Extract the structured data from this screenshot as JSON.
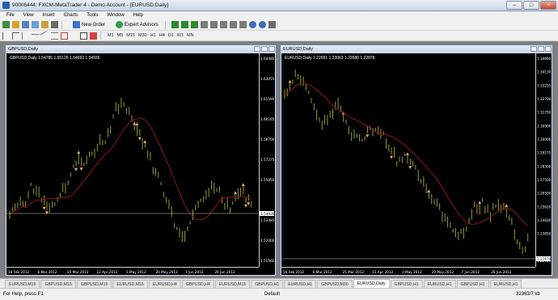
{
  "window": {
    "title": "90006444: FXCM-MetaTrader 4 - Demo Account - [EURUSD,Daily]",
    "min": "‒",
    "max": "□",
    "close": "×"
  },
  "menu": [
    "File",
    "View",
    "Insert",
    "Charts",
    "Tools",
    "Window",
    "Help"
  ],
  "toolbar": {
    "new_order": "New Order",
    "expert_advisors": "Expert Advisors",
    "timeframes": [
      "M1",
      "M5",
      "M15",
      "M30",
      "H1",
      "H4",
      "D1",
      "W1",
      "MN"
    ]
  },
  "charts": [
    {
      "title": "GBPUSD,Daily",
      "symbol_line": "GBPUSD,Daily  1.54785 1.55126 1.54693 1.54936",
      "price_labels": [
        "1.64480",
        "1.63055",
        "1.61590",
        "1.60165",
        "1.58700",
        "1.57275",
        "1.55850",
        "1.54936",
        "1.53385",
        "1.52000",
        "1.51560"
      ],
      "current_price": "1.54936",
      "date_labels": [
        "16 Feb 2012",
        "6 Mar 2012",
        "25 Mar 2012",
        "12 Apr 2012",
        "1 May 2012",
        "20 May 2012",
        "7 Jun 2012",
        "26 Jun 2012"
      ],
      "colors": {
        "candle": "#9a9a2a",
        "ma": "#8b1a1a",
        "fractal": "#f0b070",
        "line": "#d0d0d0"
      }
    },
    {
      "title": "EURUSD,Daily",
      "symbol_line": "EURUSD,Daily  1.22691 1.23063 1.22680 1.22878",
      "price_labels": [
        "1.34660",
        "1.34130",
        "1.33255",
        "1.32700",
        "1.31750",
        "1.30900",
        "1.30000",
        "1.29175",
        "1.28300",
        "1.27500",
        "1.26500",
        "1.25620",
        "1.24630",
        "1.23850",
        "1.22878",
        "1.22060"
      ],
      "current_price": "1.22878",
      "date_labels": [
        "16 Feb 2012",
        "6 Mar 2012",
        "25 Mar 2012",
        "12 Apr 2012",
        "1 May 2012",
        "20 May 2012",
        "7 Jun 2012",
        "26 Jun 2012"
      ],
      "colors": {
        "candle": "#9a9a2a",
        "ma": "#8b1a1a",
        "fractal": "#f0b070",
        "line": "#d0d0d0"
      }
    }
  ],
  "tabs": [
    "EURUSD,M15",
    "GBPUSD,M15",
    "GBPUSD,M15",
    "EURUSD,M15",
    "EURUSD,H4",
    "GBPUSD,H4",
    "EURUSD,M15",
    "GBPUSD,H1",
    "EURUSD,H1",
    "GBPUSD,M30",
    "EURUSD,Daily",
    "GBPUSD,H1",
    "EURUSD,H1",
    "GBPUSD,H1",
    "EURUSD,H1"
  ],
  "active_tab": 10,
  "status": {
    "help": "For Help, press F1",
    "profile": "Default",
    "traffic": "32363/7 kb"
  }
}
